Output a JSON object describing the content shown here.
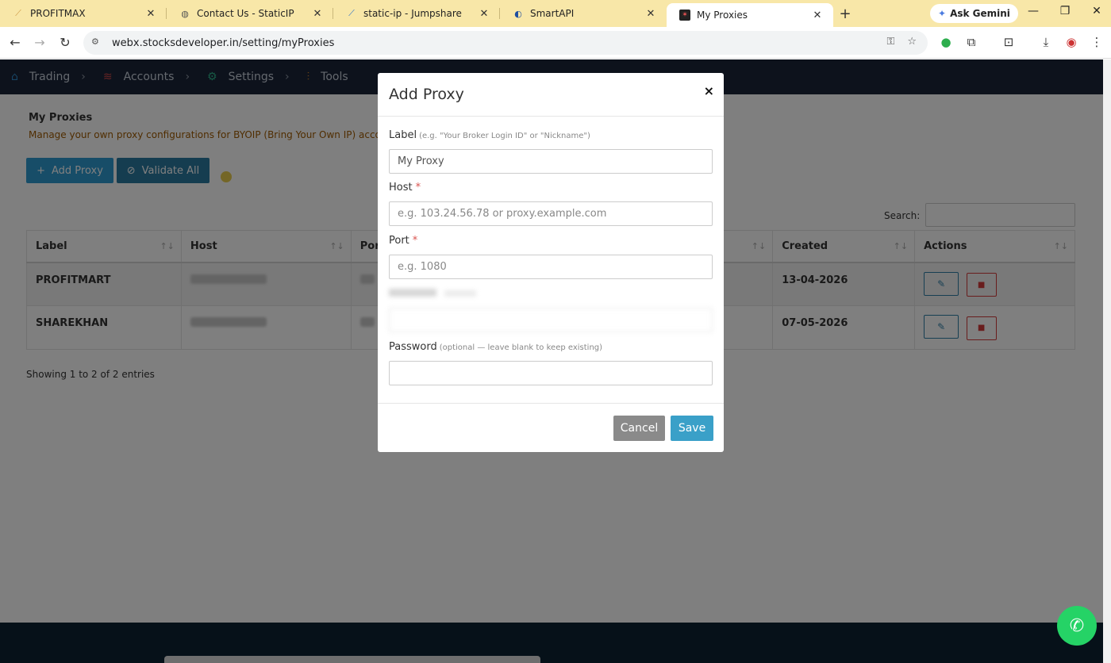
{
  "browser": {
    "tabs": [
      {
        "label": "PROFITMAX",
        "icon": "profitmax-favicon"
      },
      {
        "label": "Contact Us - StaticIP",
        "icon": "globe-favicon"
      },
      {
        "label": "static-ip - Jumpshare",
        "icon": "jumpshare-favicon"
      },
      {
        "label": "SmartAPI",
        "icon": "smartapi-favicon"
      },
      {
        "label": "My Proxies",
        "icon": "stocksdeveloper-favicon",
        "active": true
      }
    ],
    "gemini_label": "Ask Gemini",
    "url": "webx.stocksdeveloper.in/setting/myProxies"
  },
  "nav": {
    "items": [
      {
        "label": "Trading",
        "icon": "bank-icon"
      },
      {
        "label": "Accounts",
        "icon": "layers-icon"
      },
      {
        "label": "Settings",
        "icon": "gear-icon"
      },
      {
        "label": "Tools",
        "icon": "sliders-icon"
      }
    ]
  },
  "page": {
    "title": "My Proxies",
    "description": "Manage your own proxy configurations for BYOIP (Bring Your Own IP) accou",
    "add_button": "Add Proxy",
    "validate_button": "Validate All",
    "search_label": "Search:",
    "showing": "Showing 1 to 2 of 2 entries"
  },
  "table": {
    "columns": [
      "Label",
      "Host",
      "Por",
      "Created",
      "Actions"
    ],
    "rows": [
      {
        "label": "PROFITMART",
        "created": "13-04-2026"
      },
      {
        "label": "SHAREKHAN",
        "created": "07-05-2026"
      }
    ]
  },
  "modal": {
    "title": "Add Proxy",
    "close": "×",
    "label_field": {
      "label": "Label",
      "hint": "(e.g. \"Your Broker Login ID\" or \"Nickname\")",
      "value": "My Proxy"
    },
    "host_field": {
      "label": "Host",
      "required": "*",
      "placeholder": "e.g. 103.24.56.78 or proxy.example.com"
    },
    "port_field": {
      "label": "Port",
      "required": "*",
      "placeholder": "e.g. 1080"
    },
    "password_field": {
      "label": "Password",
      "hint": "(optional — leave blank to keep existing)",
      "value": ""
    },
    "cancel": "Cancel",
    "save": "Save"
  },
  "colors": {
    "tabbar": "#f8e7a8",
    "appnav": "#1b2538",
    "primary": "#2f9ad0",
    "danger": "#d23b3b",
    "whatsapp": "#25d366"
  }
}
